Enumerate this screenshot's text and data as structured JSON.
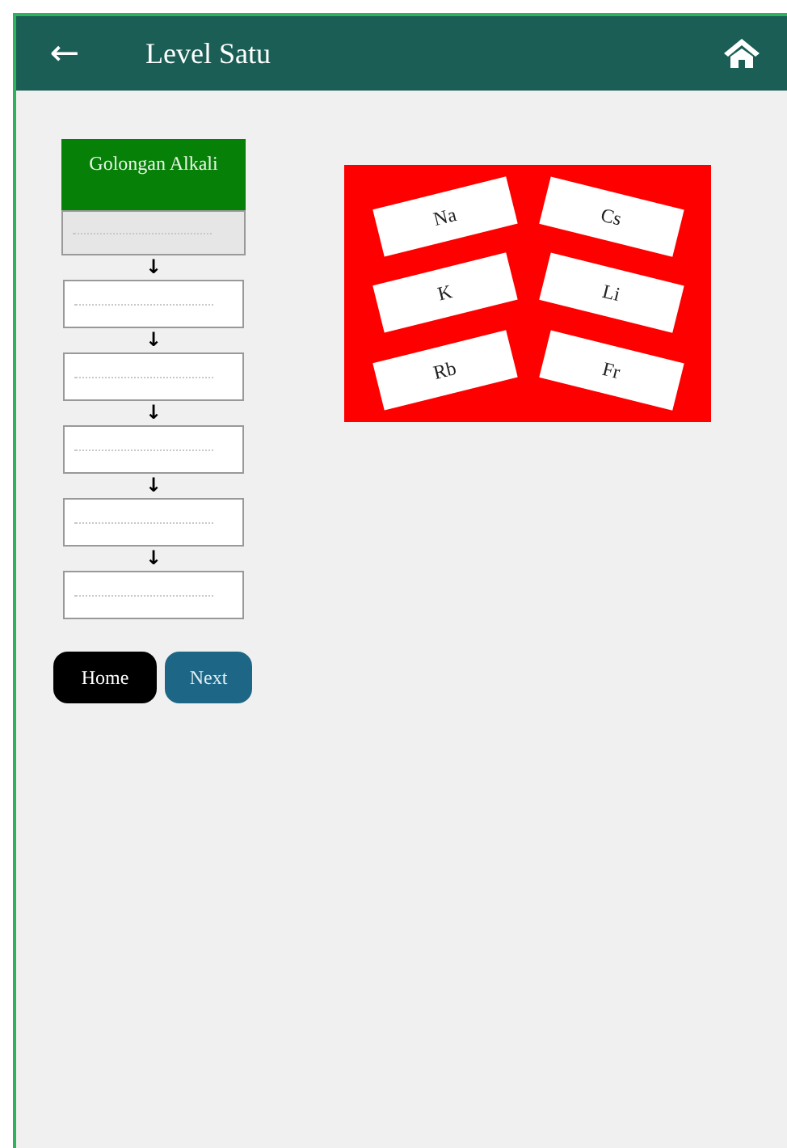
{
  "app_bar": {
    "back": "←",
    "title": "Level Satu"
  },
  "chain": {
    "heading": "Golongan Alkali",
    "slots": [
      {
        "active": true
      },
      {
        "active": false
      },
      {
        "active": false
      },
      {
        "active": false
      },
      {
        "active": false
      },
      {
        "active": false
      }
    ],
    "arrow": "↓"
  },
  "buttons": [
    {
      "label": "Home",
      "kind": "home"
    },
    {
      "label": "Next",
      "kind": "next"
    }
  ],
  "cards": [
    "Na",
    "Cs",
    "K",
    "Li",
    "Rb",
    "Fr"
  ]
}
